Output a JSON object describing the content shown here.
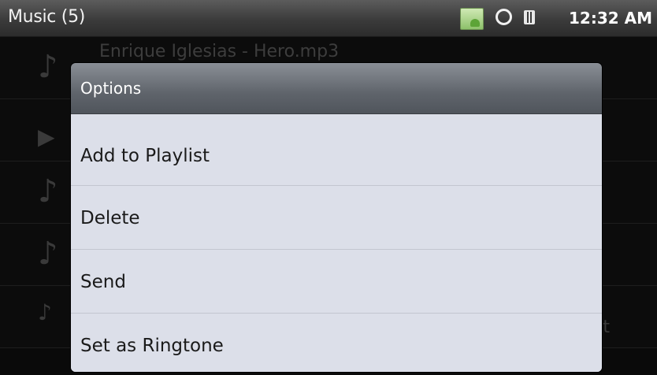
{
  "statusbar": {
    "title": "Music (5)",
    "time": "12:32 AM",
    "icons": [
      "android-notification-icon",
      "sync-icon",
      "sd-card-icon"
    ]
  },
  "song_list": {
    "items": [
      {
        "title": "Enrique Iglesias - Hero.mp3",
        "icon": "music-note-icon",
        "glyph": "♪"
      },
      {
        "title": "",
        "icon": "play-icon",
        "glyph": "▶"
      },
      {
        "title": "",
        "icon": "music-note-icon",
        "glyph": "♪"
      },
      {
        "title": "",
        "icon": "music-note-icon",
        "glyph": "♪"
      },
      {
        "title": "",
        "icon": "music-note-icon",
        "glyph": "♪",
        "trail": "t"
      }
    ]
  },
  "dialog": {
    "title": "Options",
    "options": [
      "Add to Playlist",
      "Delete",
      "Send",
      "Set as Ringtone"
    ]
  },
  "colors": {
    "dialog_body": "#dcdfe9",
    "dialog_header": "#5f646b",
    "background": "#0a0a0a"
  }
}
